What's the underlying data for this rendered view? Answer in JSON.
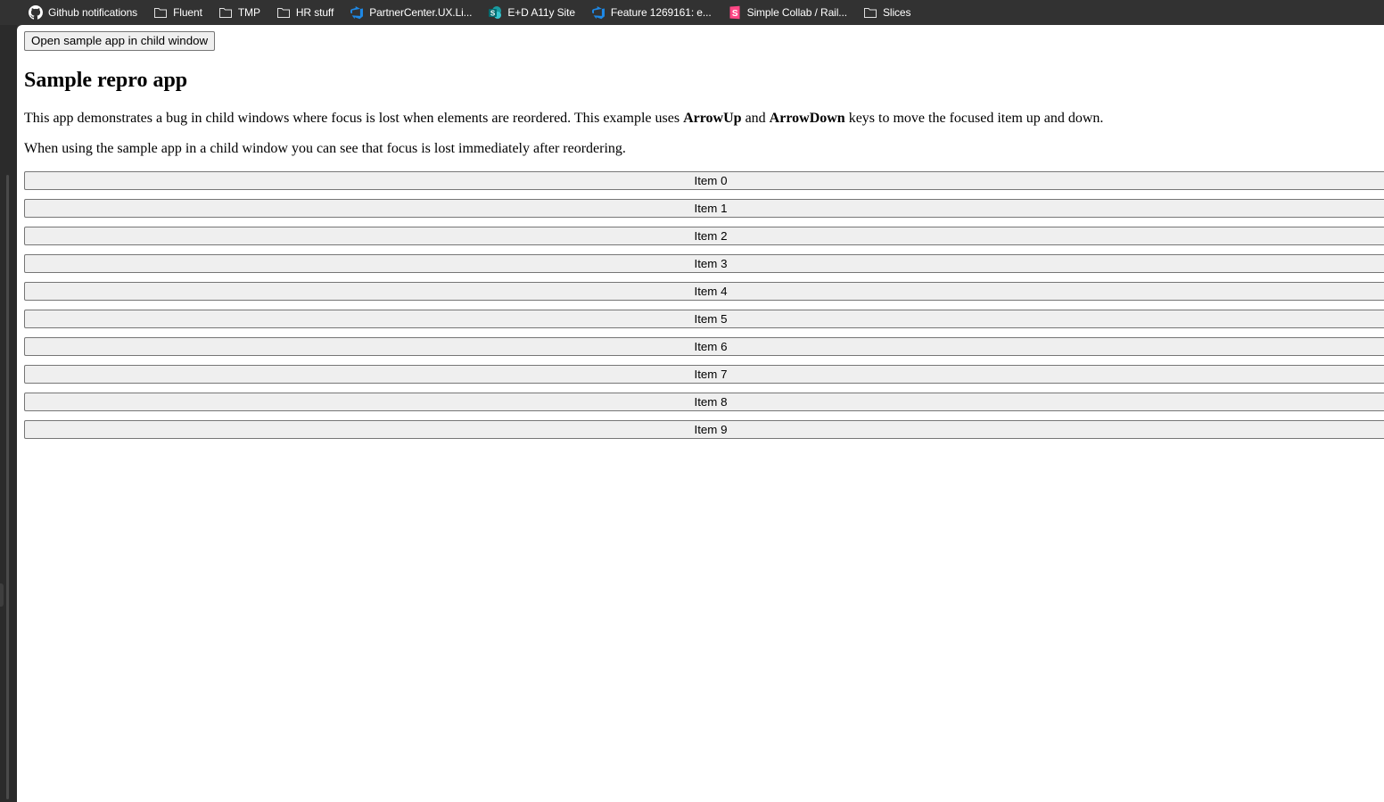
{
  "bookmarks": [
    {
      "label": "Github notifications",
      "icon": "github-icon"
    },
    {
      "label": "Fluent",
      "icon": "folder-icon"
    },
    {
      "label": "TMP",
      "icon": "folder-icon"
    },
    {
      "label": "HR stuff",
      "icon": "folder-icon"
    },
    {
      "label": "PartnerCenter.UX.Li...",
      "icon": "azure-devops-icon"
    },
    {
      "label": "E+D A11y Site",
      "icon": "sharepoint-icon"
    },
    {
      "label": "Feature 1269161: e...",
      "icon": "azure-devops-icon"
    },
    {
      "label": "Simple Collab / Rail...",
      "icon": "storybook-icon"
    },
    {
      "label": "Slices",
      "icon": "folder-icon"
    }
  ],
  "colors": {
    "chrome_bg": "#323232",
    "page_bg": "#ffffff",
    "button_bg": "#efefef",
    "button_border": "#767676",
    "azure_blue": "#1e88e5",
    "sharepoint_teal": "#036c70",
    "storybook_pink": "#ff4785"
  },
  "page": {
    "open_button_label": "Open sample app in child window",
    "title": "Sample repro app",
    "para1": {
      "pre": "This app demonstrates a bug in child windows where focus is lost when elements are reordered. This example uses ",
      "key_up": "ArrowUp",
      "mid": " and ",
      "key_down": "ArrowDown",
      "post": " keys to move the focused item up and down."
    },
    "para2": "When using the sample app in a child window you can see that focus is lost immediately after reordering.",
    "items": [
      "Item 0",
      "Item 1",
      "Item 2",
      "Item 3",
      "Item 4",
      "Item 5",
      "Item 6",
      "Item 7",
      "Item 8",
      "Item 9"
    ]
  }
}
